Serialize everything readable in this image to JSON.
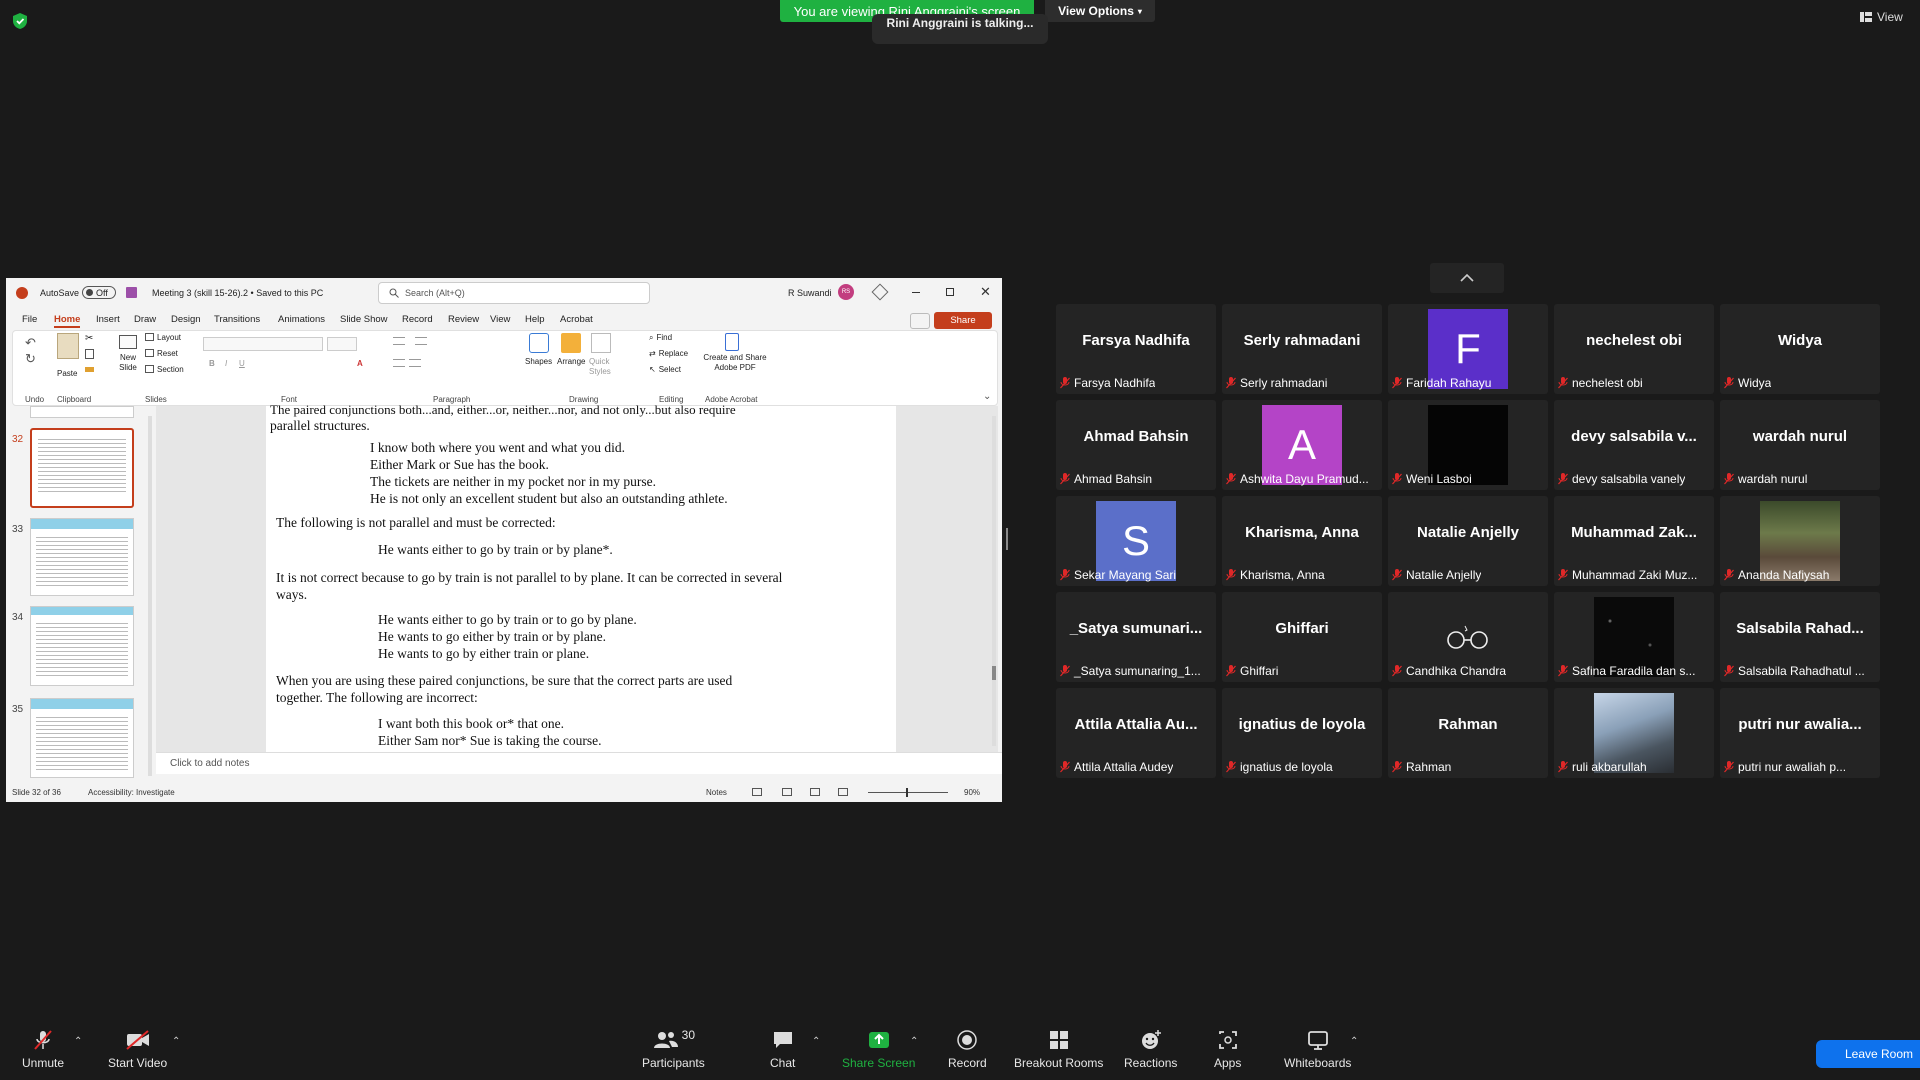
{
  "top": {
    "banner": "You are viewing Rini Anggraini's screen",
    "view_options": "View Options",
    "talking": "Rini Anggraini is talking...",
    "view": "View"
  },
  "ppt": {
    "autosave_label": "AutoSave",
    "autosave_state": "Off",
    "file_title": "Meeting 3 (skill 15-26).2 • Saved to this PC",
    "search_placeholder": "Search (Alt+Q)",
    "user_name": "R Suwandi",
    "user_initials": "RS",
    "share": "Share",
    "tabs": [
      "File",
      "Home",
      "Insert",
      "Draw",
      "Design",
      "Transitions",
      "Animations",
      "Slide Show",
      "Record",
      "Review",
      "View",
      "Help",
      "Acrobat"
    ],
    "groups": {
      "undo": "Undo",
      "clipboard": "Clipboard",
      "slides": "Slides",
      "font": "Font",
      "paragraph": "Paragraph",
      "drawing": "Drawing",
      "editing": "Editing",
      "adobe": "Adobe Acrobat"
    },
    "ribbon": {
      "paste": "Paste",
      "new_slide": "New Slide",
      "layout": "Layout",
      "reset": "Reset",
      "section": "Section",
      "shapes": "Shapes",
      "arrange": "Arrange",
      "quick_styles": "Quick Styles",
      "find": "Find",
      "replace": "Replace",
      "select": "Select",
      "create_share": "Create and Share Adobe PDF"
    },
    "thumb_numbers": [
      "32",
      "33",
      "34",
      "35"
    ],
    "notes_placeholder": "Click to add notes",
    "status": {
      "slide": "Slide 32 of 36",
      "accessibility": "Accessibility: Investigate",
      "notes": "Notes",
      "zoom": "90%"
    }
  },
  "slide": {
    "line0": "The paired conjunctions both...and, either...or, neither...nor, and not only...but also require",
    "line1": "parallel structures.",
    "ex1": "I know both where you went and what you did.",
    "ex2": "Either Mark or Sue has the book.",
    "ex3": "The tickets are neither in my pocket nor in my purse.",
    "ex4": "He is not only an excellent student but also an outstanding athlete.",
    "p2": "The following is not parallel and must be corrected:",
    "ex5": "He wants either to go by train or by plane*.",
    "p3a": "It is not correct because to go by train is not parallel to by plane. It can be corrected in several",
    "p3b": "ways.",
    "ex6": "He wants either to go by train or to go by plane.",
    "ex7": "He wants to go either by train or by plane.",
    "ex8": "He wants to go by either train or plane.",
    "p4a": "When you are using these paired conjunctions, be sure that the correct parts are used",
    "p4b": "together. The following are incorrect:",
    "ex9": "I want both this book or* that one.",
    "ex10": "Either Sam nor* Sue is taking the course."
  },
  "participants": [
    {
      "center": "Farsya Nadhifa",
      "label": "Farsya Nadhifa"
    },
    {
      "center": "Serly rahmadani",
      "label": "Serly rahmadani"
    },
    {
      "avatar": "F",
      "avatar_color": "#5b2fc9",
      "label": "Faridah Rahayu"
    },
    {
      "center": "nechelest obi",
      "label": "nechelest obi"
    },
    {
      "center": "Widya",
      "label": "Widya"
    },
    {
      "center": "Ahmad Bahsin",
      "label": "Ahmad Bahsin"
    },
    {
      "avatar": "A",
      "avatar_color": "#b444c7",
      "label": "Ashwita Dayu Pramud..."
    },
    {
      "video": "black",
      "label": "Weni Lasboi"
    },
    {
      "center": "devy salsabila v...",
      "label": "devy salsabila vanely"
    },
    {
      "center": "wardah nurul",
      "label": "wardah nurul"
    },
    {
      "avatar": "S",
      "avatar_color": "#5b6fc9",
      "label": "Sekar Mayang Sari"
    },
    {
      "center": "Kharisma, Anna",
      "label": "Kharisma, Anna"
    },
    {
      "center": "Natalie Anjelly",
      "label": "Natalie Anjelly"
    },
    {
      "center": "Muhammad  Zak...",
      "label": "Muhammad Zaki Muz..."
    },
    {
      "video": "street",
      "label": "Ananda Nafiysah"
    },
    {
      "center": "_Satya  sumunari...",
      "label": "_Satya sumunaring_1..."
    },
    {
      "center": "Ghiffari",
      "label": "Ghiffari"
    },
    {
      "video": "glasses",
      "label": "Candhika Chandra"
    },
    {
      "video": "stars",
      "label": "Safina Faradila dan s..."
    },
    {
      "center": "Salsabila  Rahad...",
      "label": "Salsabila Rahadhatul ..."
    },
    {
      "center": "Attila Attalia Au...",
      "label": "Attila Attalia Audey"
    },
    {
      "center": "ignatius de loyola",
      "label": "ignatius de loyola"
    },
    {
      "center": "Rahman",
      "label": "Rahman"
    },
    {
      "video": "photo",
      "label": "ruli akbarullah"
    },
    {
      "center": "putri  nur  awalia...",
      "label": "putri nur awaliah p..."
    }
  ],
  "toolbar": {
    "unmute": "Unmute",
    "start_video": "Start Video",
    "participants": "Participants",
    "participants_count": "30",
    "chat": "Chat",
    "share_screen": "Share Screen",
    "record": "Record",
    "breakout": "Breakout Rooms",
    "reactions": "Reactions",
    "apps": "Apps",
    "whiteboards": "Whiteboards",
    "leave": "Leave Room"
  },
  "colors": {
    "banner_green": "#1fb141",
    "leave_blue": "#0e72ed",
    "mic_red": "#e02828",
    "ppt_red": "#c43e1c"
  }
}
